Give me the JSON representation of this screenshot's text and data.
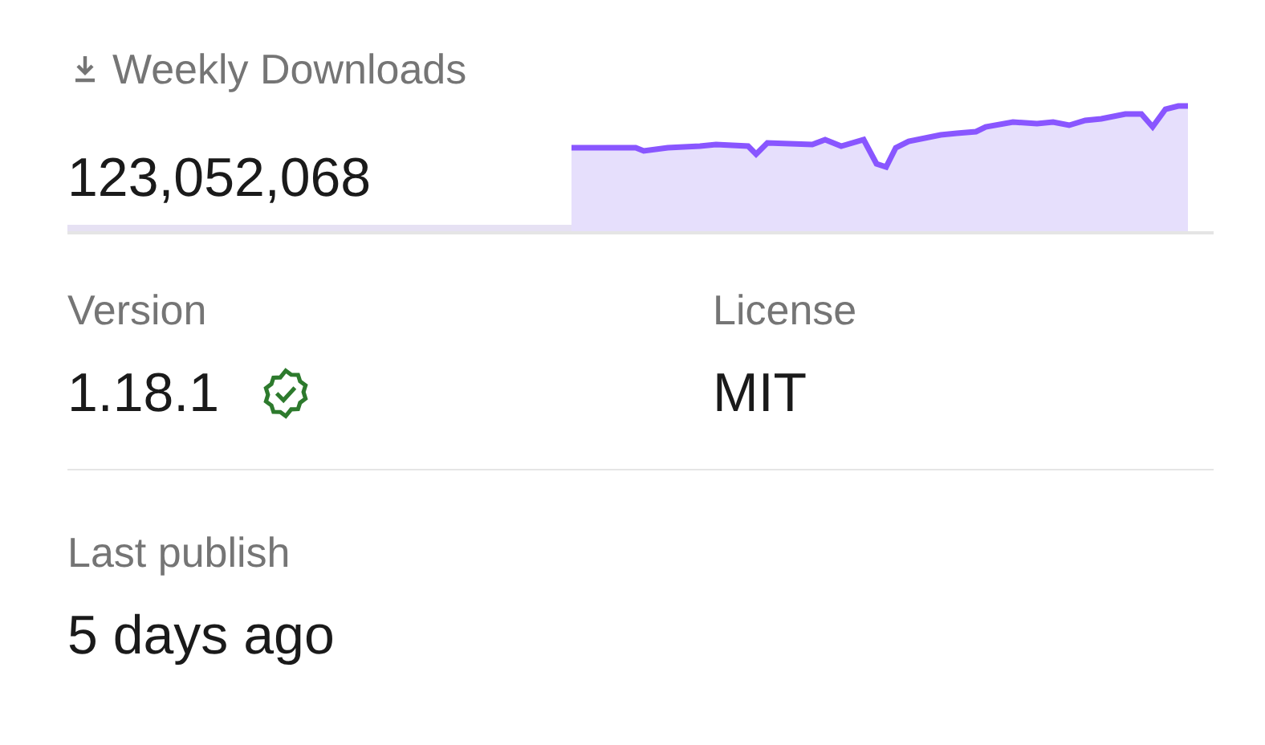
{
  "weekly_downloads": {
    "label": "Weekly Downloads",
    "count": "123,052,068"
  },
  "version": {
    "label": "Version",
    "value": "1.18.1",
    "verified": true
  },
  "license": {
    "label": "License",
    "value": "MIT"
  },
  "last_publish": {
    "label": "Last publish",
    "value": "5 days ago"
  }
}
